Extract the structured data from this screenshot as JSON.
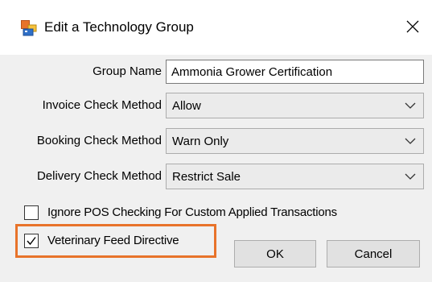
{
  "window": {
    "title": "Edit a Technology Group",
    "icon": "window-app-icon",
    "close_icon": "close-icon"
  },
  "form": {
    "group_name": {
      "label": "Group Name",
      "value": "Ammonia Grower Certification"
    },
    "invoice_check": {
      "label": "Invoice Check Method",
      "selected": "Allow"
    },
    "booking_check": {
      "label": "Booking Check Method",
      "selected": "Warn Only"
    },
    "delivery_check": {
      "label": "Delivery Check Method",
      "selected": "Restrict Sale"
    },
    "ignore_pos": {
      "label": "Ignore POS Checking For Custom Applied Transactions",
      "checked": false
    },
    "vfd": {
      "label": "Veterinary Feed Directive",
      "checked": true
    }
  },
  "buttons": {
    "ok": "OK",
    "cancel": "Cancel"
  },
  "colors": {
    "highlight": "#e8732a",
    "dialog_bg": "#f0f0f0",
    "titlebar_bg": "#ffffff",
    "select_bg": "#ebebeb",
    "button_bg": "#e1e1e1"
  }
}
